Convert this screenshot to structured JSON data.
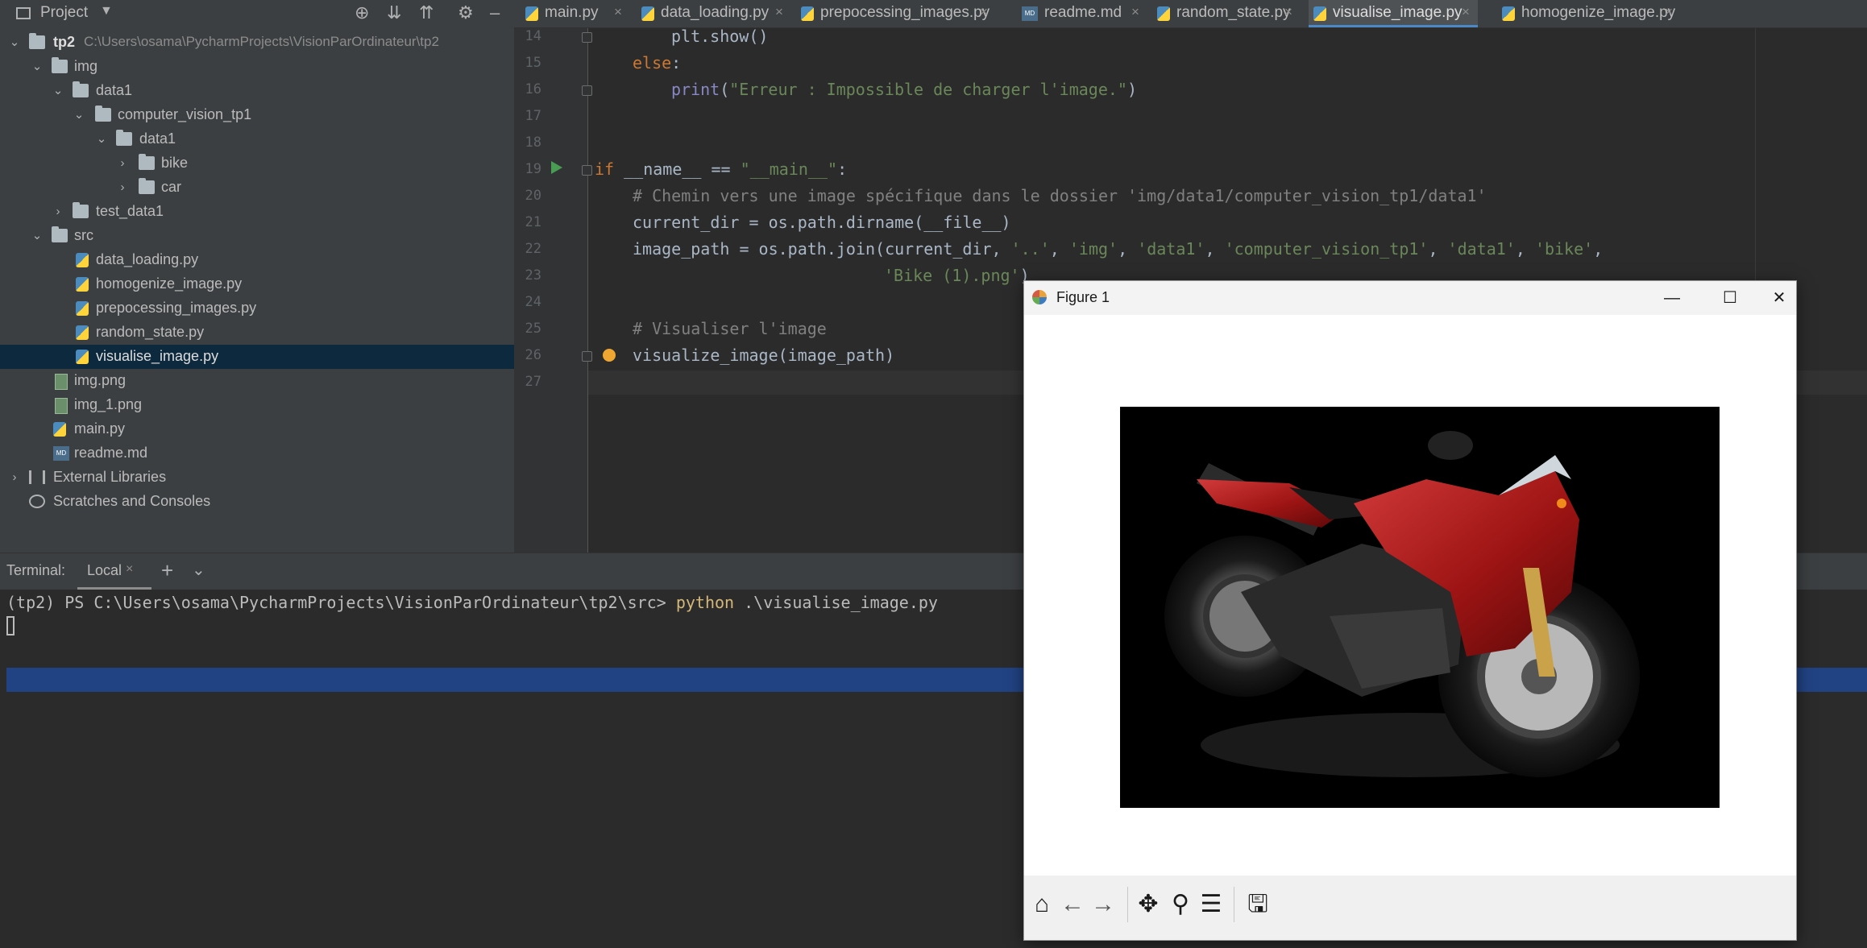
{
  "project_pane": {
    "title": "Project",
    "tree": [
      {
        "label": "tp2",
        "path_hint": "C:\\Users\\osama\\PycharmProjects\\VisionParOrdinateur\\tp2"
      },
      {
        "label": "img"
      },
      {
        "label": "data1"
      },
      {
        "label": "computer_vision_tp1"
      },
      {
        "label": "data1"
      },
      {
        "label": "bike"
      },
      {
        "label": "car"
      },
      {
        "label": "test_data1"
      },
      {
        "label": "src"
      },
      {
        "label": "data_loading.py"
      },
      {
        "label": "homogenize_image.py"
      },
      {
        "label": "prepocessing_images.py"
      },
      {
        "label": "random_state.py"
      },
      {
        "label": "visualise_image.py"
      },
      {
        "label": "img.png"
      },
      {
        "label": "img_1.png"
      },
      {
        "label": "main.py"
      },
      {
        "label": "readme.md"
      },
      {
        "label": "External Libraries"
      },
      {
        "label": "Scratches and Consoles"
      }
    ]
  },
  "editor": {
    "tabs": [
      {
        "label": "main.py"
      },
      {
        "label": "data_loading.py"
      },
      {
        "label": "prepocessing_images.py"
      },
      {
        "label": "readme.md"
      },
      {
        "label": "random_state.py"
      },
      {
        "label": "visualise_image.py",
        "active": true
      },
      {
        "label": "homogenize_image.py"
      }
    ],
    "close_glyph": "×",
    "line_numbers": [
      "14",
      "15",
      "16",
      "17",
      "18",
      "19",
      "20",
      "21",
      "22",
      "23",
      "24",
      "25",
      "26",
      "27"
    ],
    "lines": {
      "l14": "plt.show()",
      "l15_kw": "else",
      "l15_rest": ":",
      "l16_fn": "print",
      "l16_open": "(",
      "l16_str": "\"Erreur : Impossible de charger l'image.\"",
      "l16_close": ")",
      "l19_kw": "if",
      "l19_var": " __name__ == ",
      "l19_str": "\"__main__\"",
      "l19_rest": ":",
      "l20": "# Chemin vers une image spécifique dans le dossier 'img/data1/computer_vision_tp1/data1'",
      "l21": "current_dir = os.path.dirname(__file__)",
      "l22_a": "image_path = os.path.join(current_dir, ",
      "l22_b": "'..'",
      "l22_c": ", ",
      "l22_d": "'img'",
      "l22_e": ", ",
      "l22_f": "'data1'",
      "l22_g": ", ",
      "l22_h": "'computer_vision_tp1'",
      "l22_i": ", ",
      "l22_j": "'data1'",
      "l22_k": ", ",
      "l22_l": "'bike'",
      "l22_m": ",",
      "l23_str": "'Bike (1).png'",
      "l23_rest": ")",
      "l25": "# Visualiser l'image",
      "l26": "visualize_image(image_path)"
    }
  },
  "terminal": {
    "title": "Terminal:",
    "tab_label": "Local",
    "add_glyph": "+",
    "prompt": "(tp2) PS C:\\Users\\osama\\PycharmProjects\\VisionParOrdinateur\\tp2\\src> ",
    "command": "python",
    "args": " .\\visualise_image.py"
  },
  "figure": {
    "title": "Figure 1",
    "image_subject": "red sport motorcycle (Yamaha) on black background",
    "toolbar": [
      "home-icon",
      "back-arrow-icon",
      "forward-arrow-icon",
      "pan-icon",
      "zoom-icon",
      "configure-subplots-icon",
      "save-icon"
    ]
  },
  "colors": {
    "keyword": "#cc7832",
    "string": "#6a8759",
    "comment": "#808080",
    "selection": "#214283",
    "active_tab_underline": "#4a88c7"
  }
}
